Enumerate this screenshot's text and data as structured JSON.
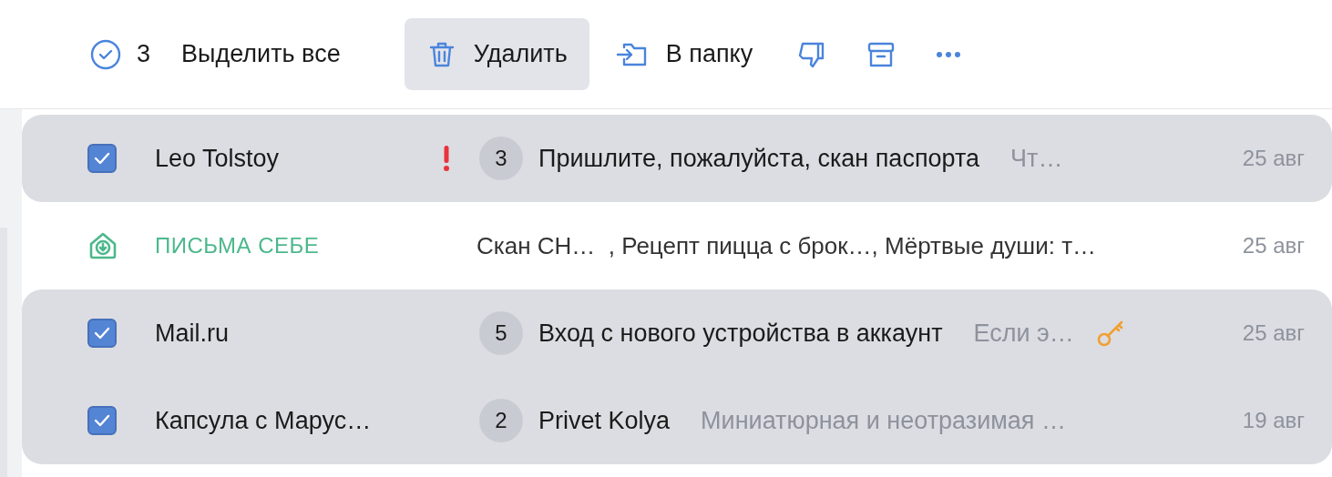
{
  "toolbar": {
    "selection": {
      "count": "3",
      "label": "Выделить все"
    },
    "actions": [
      {
        "kind": "delete",
        "label": "Удалить",
        "highlighted": true
      },
      {
        "kind": "move",
        "label": "В папку",
        "highlighted": false
      },
      {
        "kind": "spam",
        "highlighted": false
      },
      {
        "kind": "archive",
        "highlighted": false
      },
      {
        "kind": "more",
        "highlighted": false
      }
    ]
  },
  "messages": [
    {
      "kind": "mail",
      "selected": true,
      "sender": "Leo Tolstoy",
      "important": true,
      "count": "3",
      "subject": "Пришлите, пожалуйста, скан паспорта",
      "snippet": "Чт…",
      "security_notice": false,
      "date": "25 авг"
    },
    {
      "kind": "folder",
      "label": "ПИСЬМА СЕБЕ",
      "items": "Скан СН…  , Рецепт пицца с брок…, Мёртвые души: т…",
      "date": "25 авг"
    },
    {
      "kind": "mail",
      "selected": true,
      "sender": "Mail.ru",
      "important": false,
      "count": "5",
      "subject": "Вход с нового устройства в аккаунт",
      "snippet": "Если э…",
      "security_notice": true,
      "date": "25 авг"
    },
    {
      "kind": "mail",
      "selected": true,
      "sender": "Капсула с Марус…",
      "important": false,
      "count": "2",
      "subject": "Privet Kolya",
      "snippet": "Миниатюрная и неотразимая …",
      "security_notice": false,
      "date": "19 авг"
    }
  ]
}
